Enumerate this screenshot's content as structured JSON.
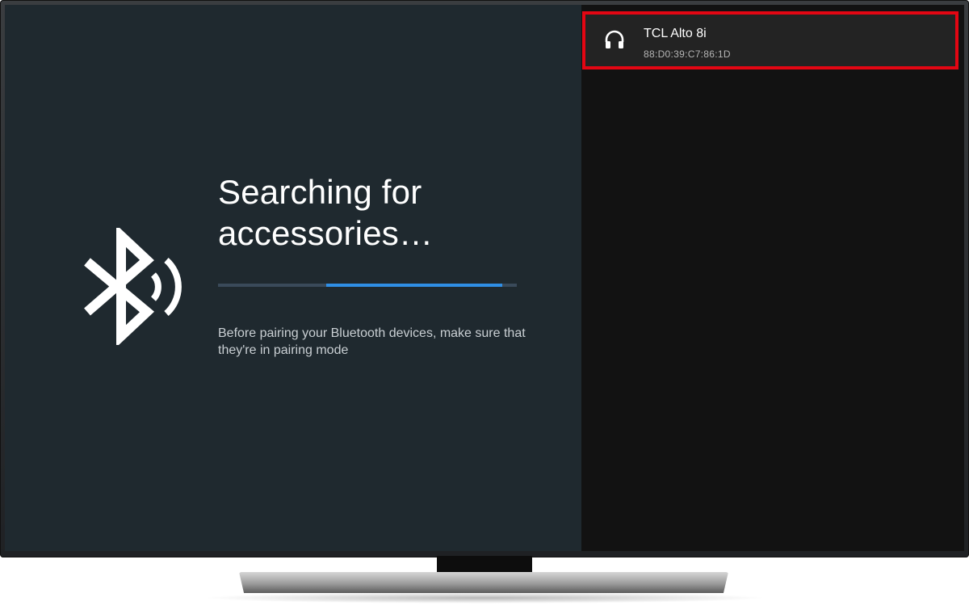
{
  "screen": {
    "title": "Searching for accessories…",
    "hint": "Before pairing your Bluetooth devices, make sure that they're in pairing mode",
    "progress_bar_visible": true
  },
  "device_list": {
    "items": [
      {
        "name": "TCL Alto 8i",
        "mac": "88:D0:39:C7:86:1D",
        "icon": "headphones-icon",
        "highlighted": true
      }
    ]
  },
  "icons": {
    "bluetooth": "bluetooth-searching-icon"
  },
  "colors": {
    "left_panel_bg": "#1f292f",
    "right_panel_bg": "#121212",
    "accent": "#2f8fe6",
    "highlight_border": "#e30613"
  }
}
